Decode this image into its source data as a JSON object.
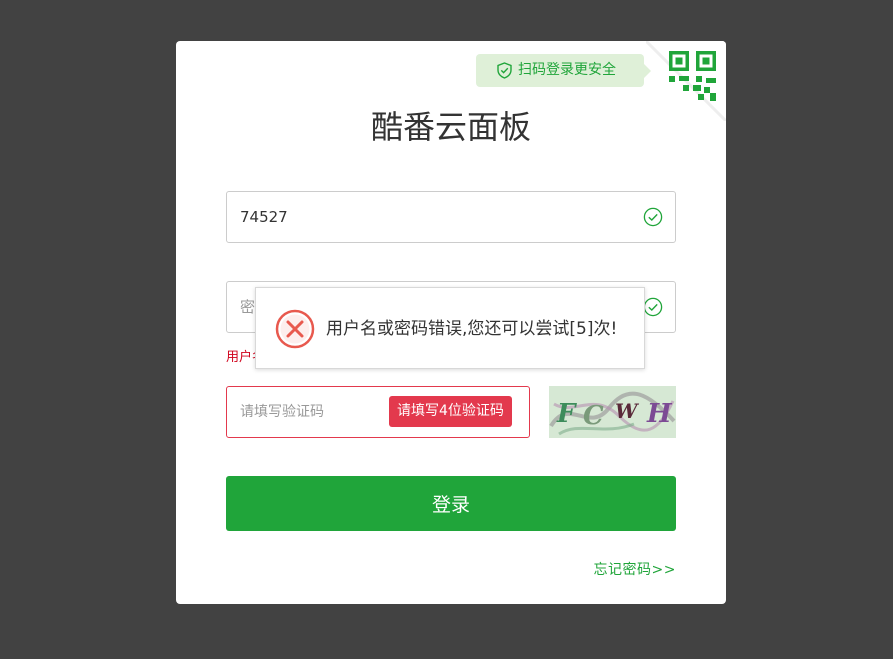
{
  "qr_login": {
    "tip": "扫码登录更安全"
  },
  "title": "酷番云面板",
  "username": {
    "value": "74527"
  },
  "password": {
    "placeholder": "密码"
  },
  "error": {
    "inline_text": "用户名或密码错误"
  },
  "captcha": {
    "placeholder": "请填写验证码",
    "tip": "请填写4位验证码",
    "image_text": "FCWH"
  },
  "login_button": "登录",
  "forgot_link": "忘记密码>>",
  "toast": {
    "message": "用户名或密码错误,您还可以尝试[5]次!"
  },
  "colors": {
    "background": "#424242",
    "brand_green": "#20a53a",
    "error_red": "#e3394d",
    "tip_bg": "#dff0d8"
  },
  "icons": {
    "qr_tip": "shield-check-icon",
    "qr_corner": "qr-code-icon",
    "field_valid": "check-circle-icon",
    "toast": "error-circle-icon"
  }
}
